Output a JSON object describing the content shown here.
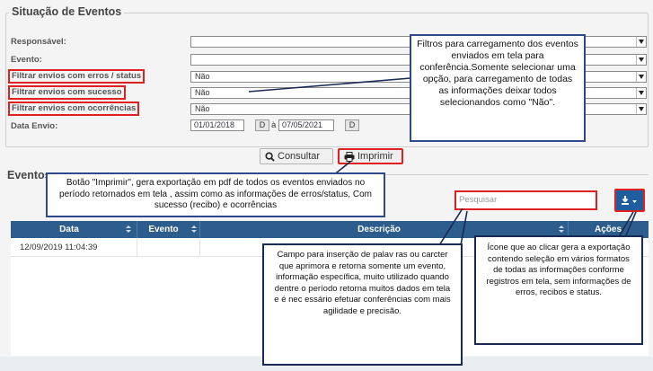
{
  "filters": {
    "legend": "Situação de Eventos",
    "labels": {
      "responsavel": "Responsável:",
      "evento": "Evento:",
      "erros_status": "Filtrar envios com erros / status",
      "sucesso": "Filtrar envios com sucesso",
      "ocorrencias": "Filtrar envios com ocorrências",
      "data_envio": "Data Envio:"
    },
    "values": {
      "responsavel": "",
      "evento": "",
      "erros_status": "Não",
      "sucesso": "Não",
      "ocorrencias": "Não"
    },
    "date_from": "01/01/2018",
    "date_to": "07/05/2021",
    "date_btn": "D",
    "date_separator": "à"
  },
  "actions": {
    "consultar": "Consultar",
    "imprimir": "Imprimir"
  },
  "events": {
    "legend": "Eventos",
    "search_placeholder": "Pesquisar",
    "columns": [
      "Data",
      "Evento",
      "Descrição",
      "Ações"
    ],
    "rows": [
      {
        "data": "12/09/2019 11:04:39",
        "evento": "",
        "descricao": ""
      }
    ]
  },
  "callouts": {
    "filtros": "Filtros para carregamento dos eventos enviados em tela para conferência.Somente selecionar uma opção, para carregamento de todas as informações deixar todos selecionandos como \"Não\".",
    "imprimir": "Botão \"Imprimir\", gera exportação em pdf de todos os eventos enviados no período retornados em tela , assim como as informações de erros/status, Com sucesso (recibo) e ocorrências",
    "pesquisar": "Campo para inserção de palav ras ou carcter que aprimora e retorna somente um evento, informação específica, muito utilizado quando dentre o período retorna muitos dados em tela e é nec essário efetuar conferências com mais agilidade e precisão.",
    "exportar": "Ícone que ao clicar gera a exportação contendo seleção em vários formatos de todas as informações conforme registros em tela, sem informações de erros, recibos e status."
  },
  "colors": {
    "header_blue": "#2d5d8c",
    "highlight_red": "#e02020",
    "callout_border": "#2f4a8a",
    "view_icon": "#1f6fb5",
    "warning_icon": "#2a6fbe"
  }
}
